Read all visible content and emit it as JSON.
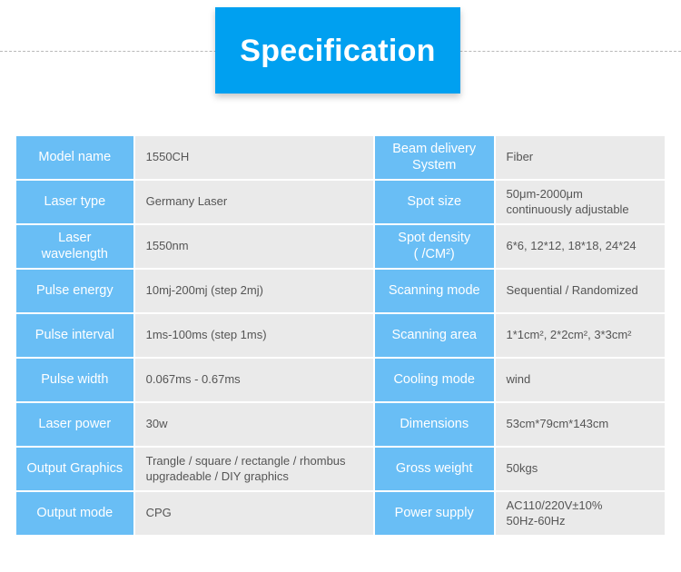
{
  "header": {
    "title": "Specification",
    "banner_color": "#00a0f0",
    "divider_style": "dashed-horizontal-line"
  },
  "theme": {
    "label_cell_color": "#69bef5",
    "value_cell_color": "#eaeaea",
    "label_text_color": "#ffffff",
    "value_text_color": "#555555"
  },
  "table": {
    "rows": [
      {
        "left": {
          "label": "Model name",
          "value": "1550CH"
        },
        "right": {
          "label": "Beam delivery\nSystem",
          "value": "Fiber"
        }
      },
      {
        "left": {
          "label": "Laser type",
          "value": "Germany Laser"
        },
        "right": {
          "label": "Spot size",
          "value": "50μm-2000μm\ncontinuously adjustable"
        }
      },
      {
        "left": {
          "label": "Laser\nwavelength",
          "value": "1550nm"
        },
        "right": {
          "label": "Spot density\n( /CM²)",
          "value": "6*6, 12*12, 18*18, 24*24"
        }
      },
      {
        "left": {
          "label": "Pulse energy",
          "value": "10mj-200mj (step 2mj)"
        },
        "right": {
          "label": "Scanning mode",
          "value": "Sequential / Randomized"
        }
      },
      {
        "left": {
          "label": "Pulse interval",
          "value": "1ms-100ms (step 1ms)"
        },
        "right": {
          "label": "Scanning area",
          "value": "1*1cm², 2*2cm², 3*3cm²"
        }
      },
      {
        "left": {
          "label": "Pulse width",
          "value": "0.067ms - 0.67ms"
        },
        "right": {
          "label": "Cooling mode",
          "value": "wind"
        }
      },
      {
        "left": {
          "label": "Laser power",
          "value": "30w"
        },
        "right": {
          "label": "Dimensions",
          "value": "53cm*79cm*143cm"
        }
      },
      {
        "left": {
          "label": "Output Graphics",
          "value": "Trangle / square / rectangle / rhombus\nupgradeable / DIY graphics"
        },
        "right": {
          "label": "Gross weight",
          "value": "50kgs"
        }
      },
      {
        "left": {
          "label": "Output mode",
          "value": "CPG"
        },
        "right": {
          "label": "Power supply",
          "value": "AC110/220V±10%\n50Hz-60Hz"
        }
      }
    ]
  }
}
